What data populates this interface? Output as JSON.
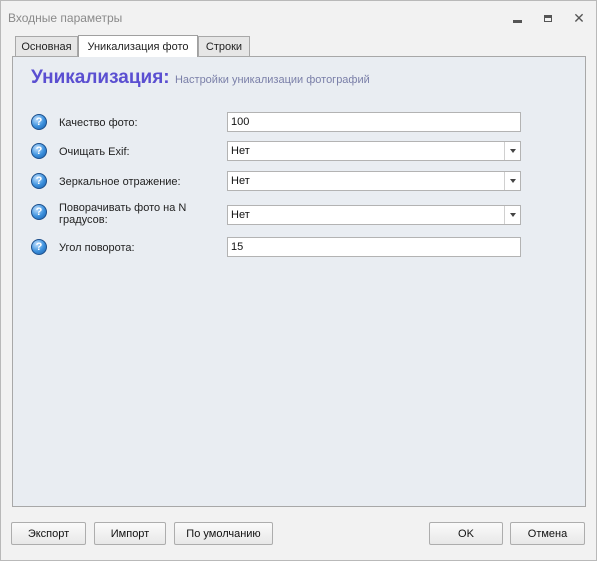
{
  "window": {
    "title": "Входные параметры"
  },
  "tabs": [
    {
      "label": "Основная"
    },
    {
      "label": "Уникализация фото"
    },
    {
      "label": "Строки"
    }
  ],
  "active_tab": "Уникализация фото",
  "heading": {
    "main": "Уникализация:",
    "sub": "Настройки уникализации фотографий"
  },
  "params": [
    {
      "label": "Качество фото:",
      "type": "text",
      "value": "100"
    },
    {
      "label": "Очищать Exif:",
      "type": "combo",
      "value": "Нет"
    },
    {
      "label": "Зеркальное отражение:",
      "type": "combo",
      "value": "Нет"
    },
    {
      "label": "Поворачивать фото на N\nградусов:",
      "type": "combo",
      "value": "Нет"
    },
    {
      "label": "Угол поворота:",
      "type": "text",
      "value": "15"
    }
  ],
  "buttons": {
    "export": "Экспорт",
    "import": "Импорт",
    "default": "По умолчанию",
    "ok": "OK",
    "cancel": "Отмена"
  },
  "colors": {
    "heading": "#5b4fd1",
    "panel_bg": "#e9edf2",
    "help_icon": "#3a8fdc"
  }
}
